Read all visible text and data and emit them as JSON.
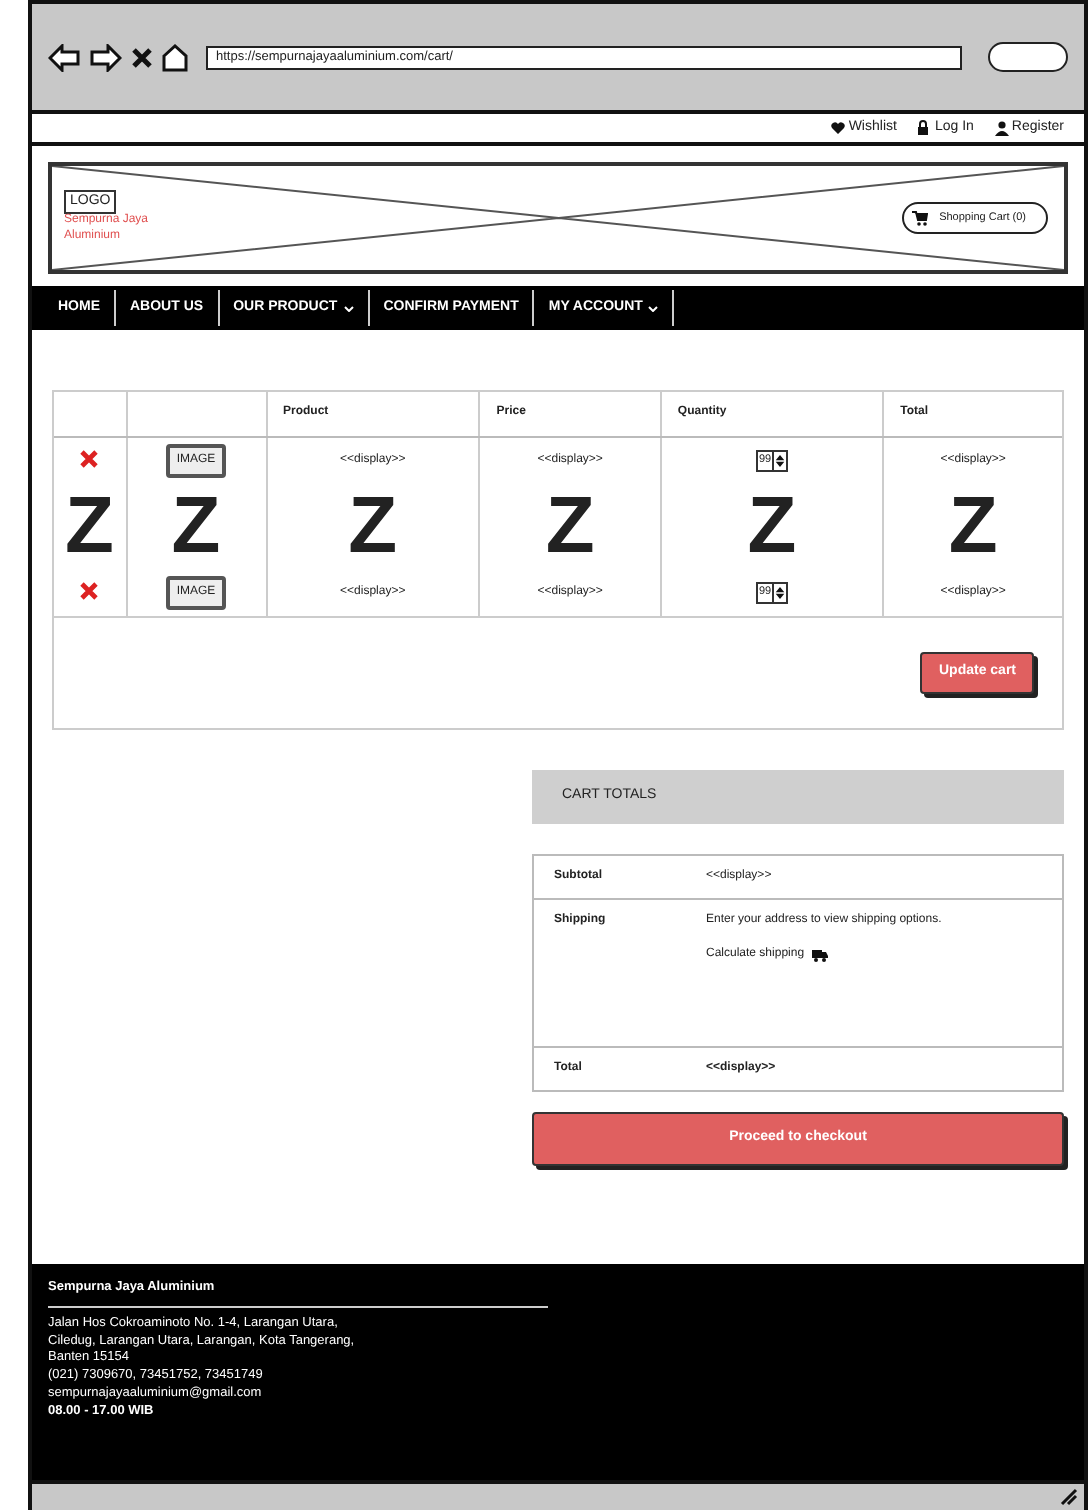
{
  "browser": {
    "url": "https://sempurnajayaaluminium.com/cart/"
  },
  "top_links": [
    {
      "kind": "heart",
      "label": "Wishlist"
    },
    {
      "kind": "lock",
      "label": "Log In"
    },
    {
      "kind": "user",
      "label": "Register"
    }
  ],
  "header": {
    "logo": "LOGO",
    "tagline": "Sempurna Jaya Aluminium",
    "cart_button": "Shopping Cart (0)"
  },
  "nav": [
    {
      "label": "HOME",
      "dropdown": false
    },
    {
      "label": "ABOUT US",
      "dropdown": false
    },
    {
      "label": "OUR PRODUCT",
      "dropdown": true
    },
    {
      "label": "CONFIRM PAYMENT",
      "dropdown": false
    },
    {
      "label": "MY ACCOUNT",
      "dropdown": true
    }
  ],
  "cart_table": {
    "columns": [
      "Product",
      "Price",
      "Quantity",
      "Total"
    ],
    "rows": [
      {
        "image": "IMAGE",
        "product": "<<display>>",
        "price": "<<display>>",
        "quantity": "99",
        "total": "<<display>>"
      },
      {
        "image": "IMAGE",
        "product": "<<display>>",
        "price": "<<display>>",
        "quantity": "99",
        "total": "<<display>>"
      }
    ],
    "z_marks": [
      "Z",
      "Z",
      "Z",
      "Z",
      "Z",
      "Z"
    ],
    "update_button": "Update cart"
  },
  "cart_totals": {
    "title": "CART TOTALS",
    "rows": [
      {
        "kind": "plain",
        "label": "Subtotal",
        "value": "<<display>>"
      },
      {
        "kind": "shipping",
        "label": "Shipping",
        "value": "Enter your address to view shipping options.",
        "link": "Calculate shipping"
      },
      {
        "kind": "strong",
        "label": "Total",
        "value": "<<display>>"
      }
    ],
    "checkout_button": "Proceed to checkout"
  },
  "footer": {
    "title": "Sempurna Jaya Aluminium",
    "lines": [
      "Jalan Hos Cokroaminoto No. 1-4, Larangan Utara,",
      "Ciledug, Larangan Utara, Larangan, Kota Tangerang,",
      "Banten 15154",
      "(021) 7309670, 73451752, 73451749",
      "sempurnajayaaluminium@gmail.com",
      "08.00 - 17.00 WIB"
    ]
  }
}
